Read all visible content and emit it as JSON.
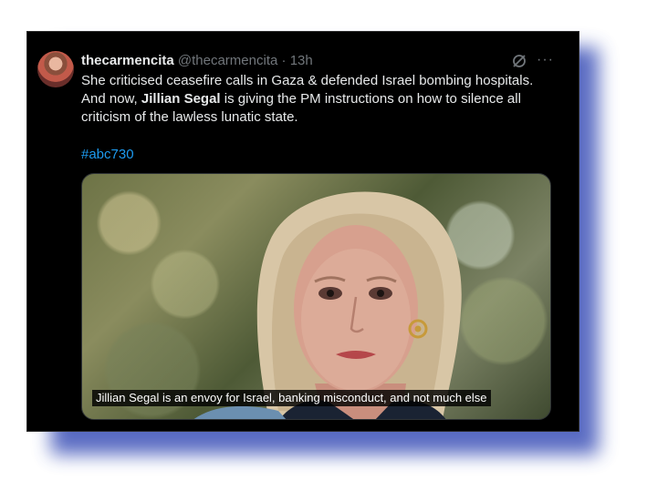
{
  "tweet": {
    "display_name": "thecarmencita",
    "handle": "@thecarmencita",
    "separator": "·",
    "time": "13h",
    "text_part1": "She criticised ceasefire calls in Gaza & defended Israel bombing hospitals. And now, ",
    "text_bold": "Jillian Segal",
    "text_part2": " is giving the PM instructions on how to silence all criticism of the lawless lunatic state.",
    "hashtag": "#abc730",
    "media_caption": "Jillian Segal is an envoy for Israel, banking misconduct, and not much else",
    "more_glyph": "···"
  },
  "icons": {
    "grok": "grok-icon",
    "more": "more-icon"
  },
  "colors": {
    "background": "#000000",
    "text": "#e7e9ea",
    "muted": "#71767b",
    "link": "#1d9bf0",
    "frame_shadow": "#3d52b8"
  }
}
